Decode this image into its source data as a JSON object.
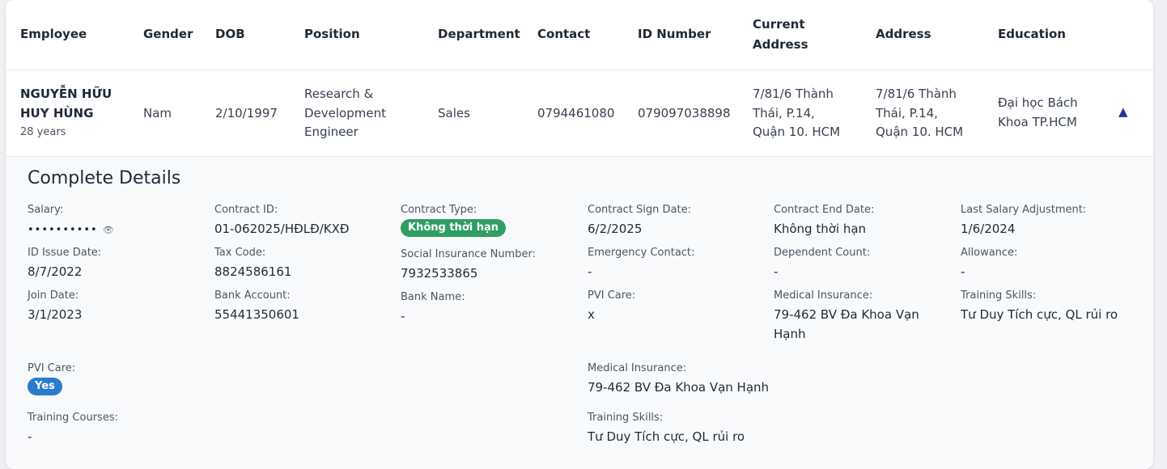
{
  "table": {
    "headers": {
      "employee": "Employee",
      "gender": "Gender",
      "dob": "DOB",
      "position": "Position",
      "department": "Department",
      "contact": "Contact",
      "id_number": "ID Number",
      "current_address_1": "Current",
      "current_address_2": "Address",
      "address": "Address",
      "education": "Education"
    },
    "row": {
      "name_line1": "NGUYỄN HỮU",
      "name_line2": "HUY HÙNG",
      "age": "28 years",
      "gender": "Nam",
      "dob": "2/10/1997",
      "position_l1": "Research &",
      "position_l2": "Development",
      "position_l3": "Engineer",
      "department": "Sales",
      "contact": "0794461080",
      "id_number": "079097038898",
      "current_address_l1": "7/81/6 Thành",
      "current_address_l2": "Thái, P.14,",
      "current_address_l3": "Quận 10. HCM",
      "address_l1": "7/81/6 Thành",
      "address_l2": "Thái, P.14,",
      "address_l3": "Quận 10. HCM",
      "education_l1": "Đại học Bách",
      "education_l2": "Khoa TP.HCM",
      "toggle_icon": "▲"
    }
  },
  "details": {
    "title": "Complete Details",
    "salary": {
      "label": "Salary:",
      "value": "••••••••••",
      "eye": "👁"
    },
    "contract_id": {
      "label": "Contract ID:",
      "value": "01-062025/HĐLĐ/KXĐ"
    },
    "contract_type": {
      "label": "Contract Type:",
      "value": "Không thời hạn"
    },
    "contract_sign_date": {
      "label": "Contract Sign Date:",
      "value": "6/2/2025"
    },
    "contract_end_date": {
      "label": "Contract End Date:",
      "value": "Không thời hạn"
    },
    "last_salary_adjustment": {
      "label": "Last Salary Adjustment:",
      "value": "1/6/2024"
    },
    "id_issue_date": {
      "label": "ID Issue Date:",
      "value": "8/7/2022"
    },
    "tax_code": {
      "label": "Tax Code:",
      "value": "8824586161"
    },
    "social_insurance": {
      "label": "Social Insurance Number:",
      "value": "7932533865"
    },
    "emergency_contact": {
      "label": "Emergency Contact:",
      "value": "-"
    },
    "dependent_count": {
      "label": "Dependent Count:",
      "value": "-"
    },
    "allowance": {
      "label": "Allowance:",
      "value": "-"
    },
    "join_date": {
      "label": "Join Date:",
      "value": "3/1/2023"
    },
    "bank_account": {
      "label": "Bank Account:",
      "value": "55441350601"
    },
    "bank_name": {
      "label": "Bank Name:",
      "value": "-"
    },
    "pvi_care": {
      "label": "PVI Care:",
      "value": "x"
    },
    "medical_insurance": {
      "label": "Medical Insurance:",
      "value_l1": "79-462 BV Đa Khoa Vạn",
      "value_l2": "Hạnh"
    },
    "training_skills": {
      "label": "Training Skills:",
      "value": "Tư Duy Tích cực, QL rủi ro"
    },
    "pvi_care_2": {
      "label": "PVI Care:",
      "value": "Yes"
    },
    "medical_insurance_2": {
      "label": "Medical Insurance:",
      "value": "79-462 BV Đa Khoa Vạn Hạnh"
    },
    "training_courses": {
      "label": "Training Courses:",
      "value": "-"
    },
    "training_skills_2": {
      "label": "Training Skills:",
      "value": "Tư Duy Tích cực, QL rủi ro"
    }
  }
}
